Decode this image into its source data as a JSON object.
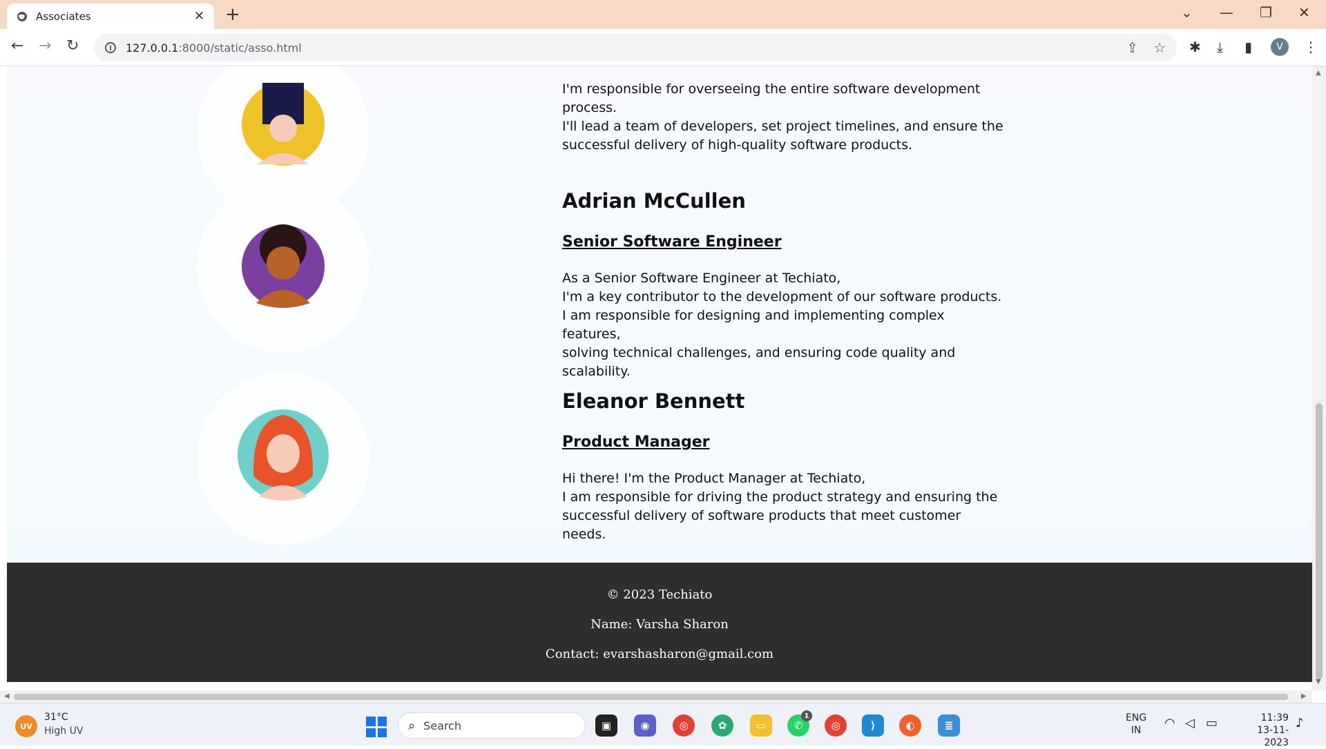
{
  "browser": {
    "tab_title": "Associates",
    "tab_close": "✕",
    "new_tab": "+",
    "url_host": "127.0.0.1",
    "url_path": ":8000/static/asso.html",
    "profile_initial": "V"
  },
  "people": [
    {
      "name": "",
      "role": "",
      "description": [
        "I'm responsible for overseeing the entire software development",
        "process.",
        "I'll lead a team of developers, set project timelines, and ensure the",
        "successful delivery of high-quality software products."
      ],
      "avatar_bg": "#f0c22a"
    },
    {
      "name": "Adrian McCullen",
      "role": "Senior Software Engineer",
      "description": [
        "As a Senior Software Engineer at Techiato,",
        "I'm a key contributor to the development of our software products.",
        "I am responsible for designing and implementing complex features,",
        "solving technical challenges, and ensuring code quality and scalability."
      ],
      "avatar_bg": "#7b3fa0"
    },
    {
      "name": "Eleanor Bennett",
      "role": "Product Manager",
      "description": [
        "Hi there! I'm the Product Manager at Techiato,",
        "I am responsible for driving the product strategy and ensuring the",
        "successful delivery of software products that meet customer needs."
      ],
      "avatar_bg": "#6fcfcb"
    }
  ],
  "footer": {
    "copyright": "© 2023 Techiato",
    "name": "Name: Varsha Sharon",
    "contact": "Contact: evarshasharon@gmail.com"
  },
  "taskbar": {
    "weather_badge": "UV",
    "temperature": "31°C",
    "weather_status": "High UV",
    "search_placeholder": "Search",
    "whatsapp_badge": "1",
    "lang_top": "ENG",
    "lang_bottom": "IN",
    "time": "11:39",
    "date": "13-11-2023"
  },
  "colors": {
    "footer_bg": "#2e2e2e",
    "tabbar_bg": "#f8d9c6"
  }
}
